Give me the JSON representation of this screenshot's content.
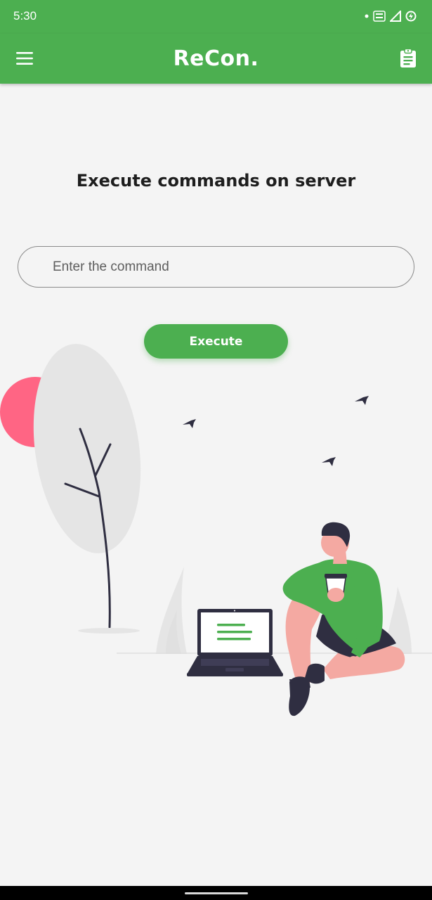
{
  "status_bar": {
    "time": "5:30"
  },
  "app_bar": {
    "title": "ReCon."
  },
  "main": {
    "heading": "Execute commands on server",
    "command_placeholder": "Enter the command",
    "command_value": "",
    "execute_label": "Execute"
  },
  "icons": [
    "menu-icon",
    "clipboard-icon",
    "signal-icon",
    "lte-icon",
    "battery-saver-icon"
  ],
  "colors": {
    "primary": "#4caf50",
    "background": "#f4f4f4",
    "accent_red": "#ff6584",
    "dark": "#2f2e41",
    "skin": "#f4a9a2"
  }
}
